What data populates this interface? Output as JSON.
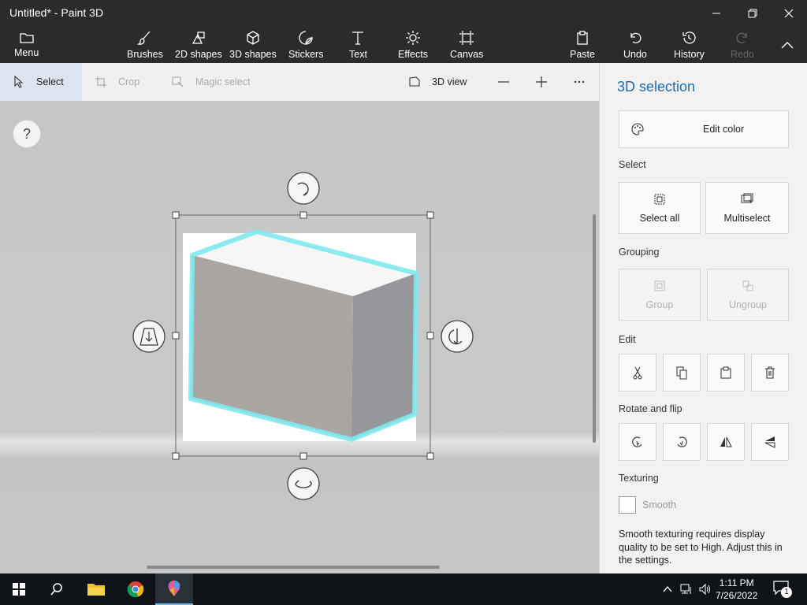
{
  "window": {
    "title": "Untitled* - Paint 3D"
  },
  "ribbon": {
    "menu": "Menu",
    "brushes": "Brushes",
    "shapes2d": "2D shapes",
    "shapes3d": "3D shapes",
    "stickers": "Stickers",
    "text": "Text",
    "effects": "Effects",
    "canvas": "Canvas",
    "paste": "Paste",
    "undo": "Undo",
    "history": "History",
    "redo": "Redo"
  },
  "subtoolbar": {
    "select": "Select",
    "crop": "Crop",
    "magic_select": "Magic select",
    "view3d": "3D view"
  },
  "canvas": {
    "help": "?"
  },
  "panel": {
    "title": "3D selection",
    "edit_color": "Edit color",
    "select_section": "Select",
    "select_all": "Select all",
    "multiselect": "Multiselect",
    "grouping_section": "Grouping",
    "group": "Group",
    "ungroup": "Ungroup",
    "edit_section": "Edit",
    "rotate_section": "Rotate and flip",
    "texturing_section": "Texturing",
    "smooth": "Smooth",
    "note": "Smooth texturing requires display quality to be set to High. Adjust this in the settings."
  },
  "taskbar": {
    "time": "1:11 PM",
    "date": "7/26/2022",
    "notification_count": "1"
  },
  "colors": {
    "accent": "#1a6bb5",
    "selection_glow": "#7fe8f0",
    "ribbon_bg": "#2b2b2b"
  }
}
